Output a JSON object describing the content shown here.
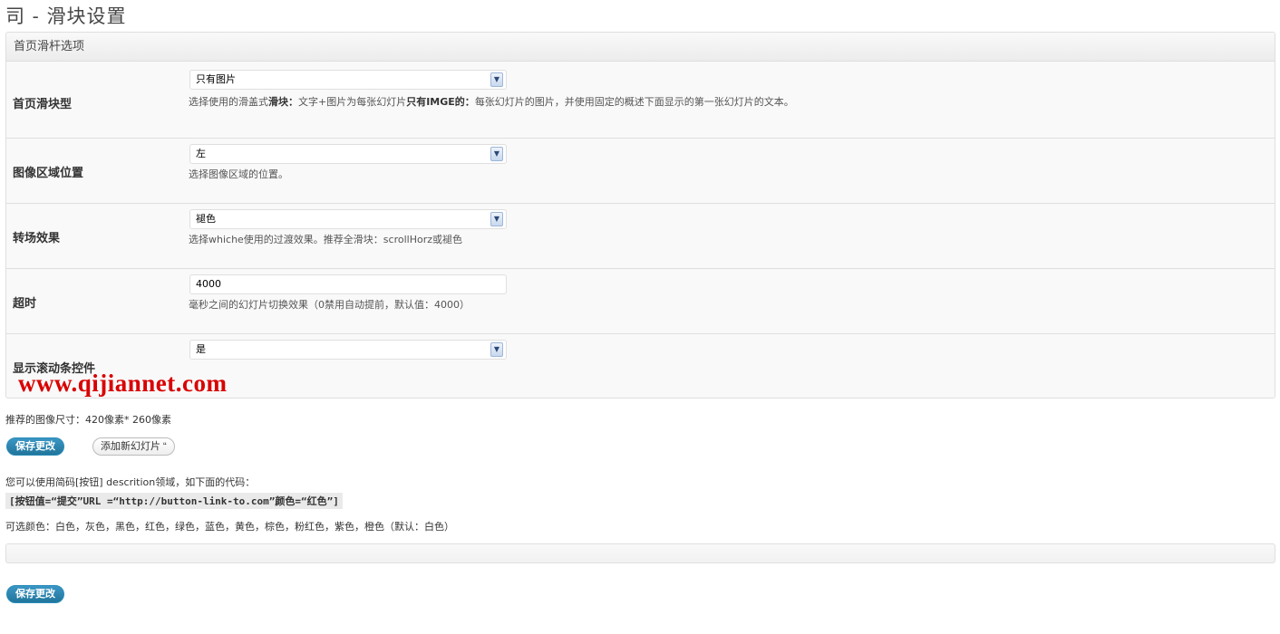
{
  "page": {
    "title": "司 - 滑块设置"
  },
  "panel": {
    "header": "首页滑杆选项",
    "rows": [
      {
        "label": "首页滑块型",
        "control": "select",
        "value": "只有图片",
        "desc_a": "选择使用的滑盖式",
        "desc_b": "滑块：",
        "desc_c": "文字+图片为每张幻灯片",
        "desc_d": "只有IMGE的：",
        "desc_e": "每张幻灯片的图片，并使用固定的概述下面显示的第一张幻灯片的文本。"
      },
      {
        "label": "图像区域位置",
        "control": "select",
        "value": "左",
        "desc": "选择图像区域的位置。"
      },
      {
        "label": "转场效果",
        "control": "select",
        "value": "褪色",
        "desc": "选择whiche使用的过渡效果。推荐全滑块：scrollHorz或褪色"
      },
      {
        "label": "超时",
        "control": "text",
        "value": "4000",
        "desc": "毫秒之间的幻灯片切换效果（0禁用自动提前，默认值：4000）"
      },
      {
        "label": "显示滚动条控件",
        "control": "select",
        "value": "是"
      }
    ]
  },
  "watermark": "www.qijiannet.com",
  "recommend": "推荐的图像尺寸：420像素* 260像素",
  "buttons": {
    "save": "保存更改",
    "add_slide": "添加新幻灯片 “"
  },
  "shortcode": {
    "intro": "您可以使用简码[按钮] descrition领域，如下面的代码：",
    "code": "[按钮值=“提交”URL =“http://button-link-to.com”颜色=“红色”]",
    "colors": "可选颜色：白色，灰色，黑色，红色，绿色，蓝色，黄色，棕色，粉红色，紫色，橙色（默认：白色）"
  },
  "icons": {
    "select_arrow": "chevron-down-icon"
  }
}
